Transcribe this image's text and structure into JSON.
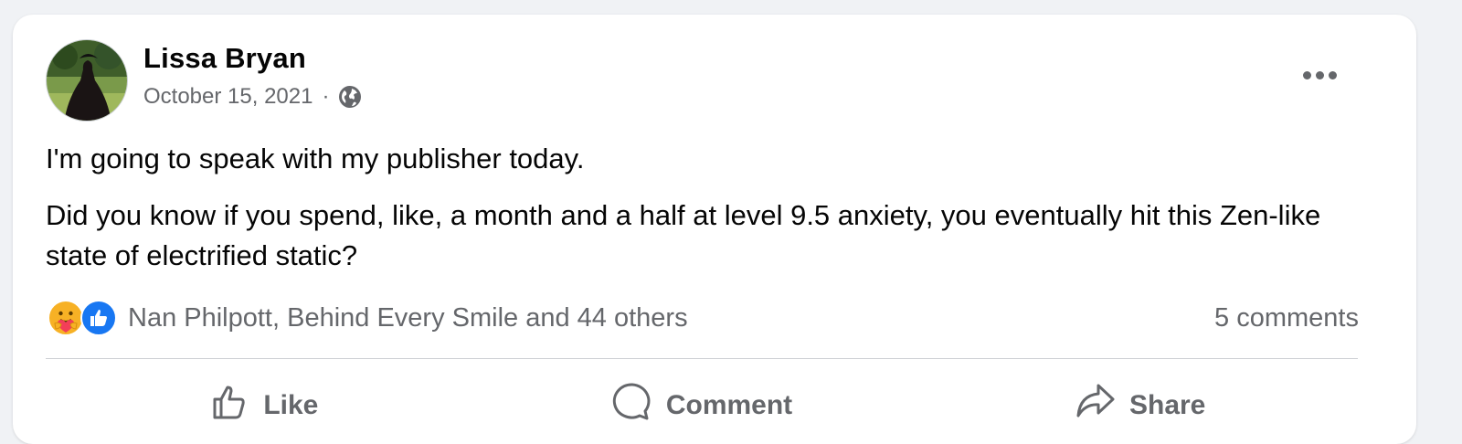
{
  "post": {
    "author": "Lissa Bryan",
    "date": "October 15, 2021",
    "separator": "·",
    "privacy_icon": "globe-icon",
    "menu_icon": "more-options-icon",
    "paragraphs": [
      "I'm going to speak with my publisher today.",
      "Did you know if you spend, like, a month and a half at level 9.5 anxiety, you eventually hit this Zen-like state of electrified static?"
    ],
    "reactions": {
      "icons": [
        "care-reaction-icon",
        "like-reaction-icon"
      ],
      "summary": "Nan Philpott, Behind Every Smile and 44 others"
    },
    "comments": "5 comments",
    "actions": [
      {
        "label": "Like",
        "icon": "thumbs-up-icon"
      },
      {
        "label": "Comment",
        "icon": "comment-icon"
      },
      {
        "label": "Share",
        "icon": "share-icon"
      }
    ]
  },
  "colors": {
    "background": "#f0f2f5",
    "card": "#ffffff",
    "primary_text": "#050505",
    "secondary_text": "#65676b",
    "like_blue": "#1877f2",
    "care_yellow": "#f7b125"
  }
}
